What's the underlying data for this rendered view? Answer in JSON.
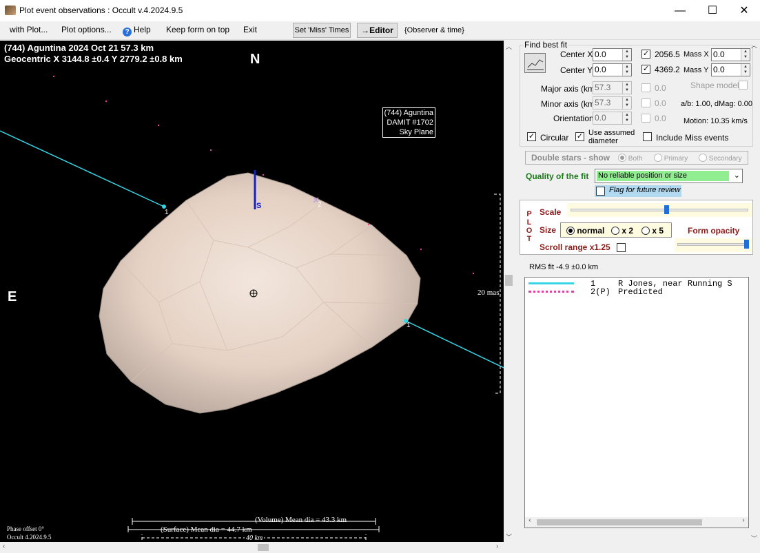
{
  "window": {
    "title": "Plot event observations : Occult v.4.2024.9.5",
    "minimize_glyph": "—",
    "maximize_glyph": "☐",
    "close_glyph": "✕"
  },
  "menu": {
    "with_plot": "with Plot...",
    "plot_options": "Plot options...",
    "help": "Help",
    "keep_on_top": "Keep form on top",
    "exit": "Exit",
    "set_miss_times": "Set 'Miss' Times",
    "editor": "→Editor",
    "observer_time": "{Observer & time}"
  },
  "plot": {
    "header_line1": "(744) Aguntina  2024 Oct 21   57.3 km",
    "header_line2": "Geocentric  X  3144.8 ±0.4  Y 2779.2 ±0.8 km",
    "north": "N",
    "east": "E",
    "south_marker": "S",
    "label_box": [
      "(744) Aguntina",
      "DAMIT #1702",
      "Sky Plane"
    ],
    "chord1_label_a": "1",
    "chord1_label_b": "1",
    "chord2_label": "2",
    "mas_label": "20 mas",
    "volume_dia": "(Volume) Mean dia = 43.3 km",
    "surface_dia": "(Surface) Mean dia = 44.7 km",
    "scale_km": "40 km",
    "phase_offset": "Phase offset 0°",
    "version_footer": "Occult 4.2024.9.5",
    "colors": {
      "chord": "#35d6e6",
      "shape": "#e7d3c8",
      "predicted": "#e040a0"
    }
  },
  "fit": {
    "group_title": "Find best fit",
    "center_x_label": "Center X",
    "center_x": "0.0",
    "center_y_label": "Center Y",
    "center_y": "0.0",
    "x_value": "2056.5",
    "y_value": "4369.2",
    "mass_x_label": "Mass X",
    "mass_x": "0.0",
    "mass_y_label": "Mass Y",
    "mass_y": "0.0",
    "major_label": "Major axis (km)",
    "major": "57.3",
    "minor_label": "Minor axis (km)",
    "minor": "57.3",
    "orient_label": "Orientation",
    "orient": "0.0",
    "major_chk_val": "0.0",
    "minor_chk_val": "0.0",
    "orient_chk_val": "0.0",
    "shape_model_label": "Shape model",
    "ab_dmag": "a/b: 1.00, dMag: 0.00",
    "motion": "Motion: 10.35 km/s",
    "circular_label": "Circular",
    "use_assumed_label": "Use assumed",
    "diameter_label": "diameter",
    "include_miss_label": "Include Miss events",
    "double_stars_label": "Double stars - show",
    "both_label": "Both",
    "primary_label": "Primary",
    "secondary_label": "Secondary",
    "quality_label": "Quality of the fit",
    "quality_value": "No reliable position or size",
    "flag_label": "Flag for future review"
  },
  "plot_panel": {
    "side_letters": [
      "P",
      "L",
      "O",
      "T"
    ],
    "scale_label": "Scale",
    "size_label": "Size",
    "normal_label": "normal",
    "x2_label": "x 2",
    "x5_label": "x 5",
    "form_opacity_label": "Form opacity",
    "scroll_range_label": "Scroll range x1.25",
    "scale_level": 0.54,
    "opacity_level": 1.0
  },
  "rms": "RMS fit -4.9 ±0.0 km",
  "legend": [
    {
      "num": "1",
      "text": "R Jones, near Running S"
    },
    {
      "num": "2(P)",
      "text": "Predicted"
    }
  ]
}
